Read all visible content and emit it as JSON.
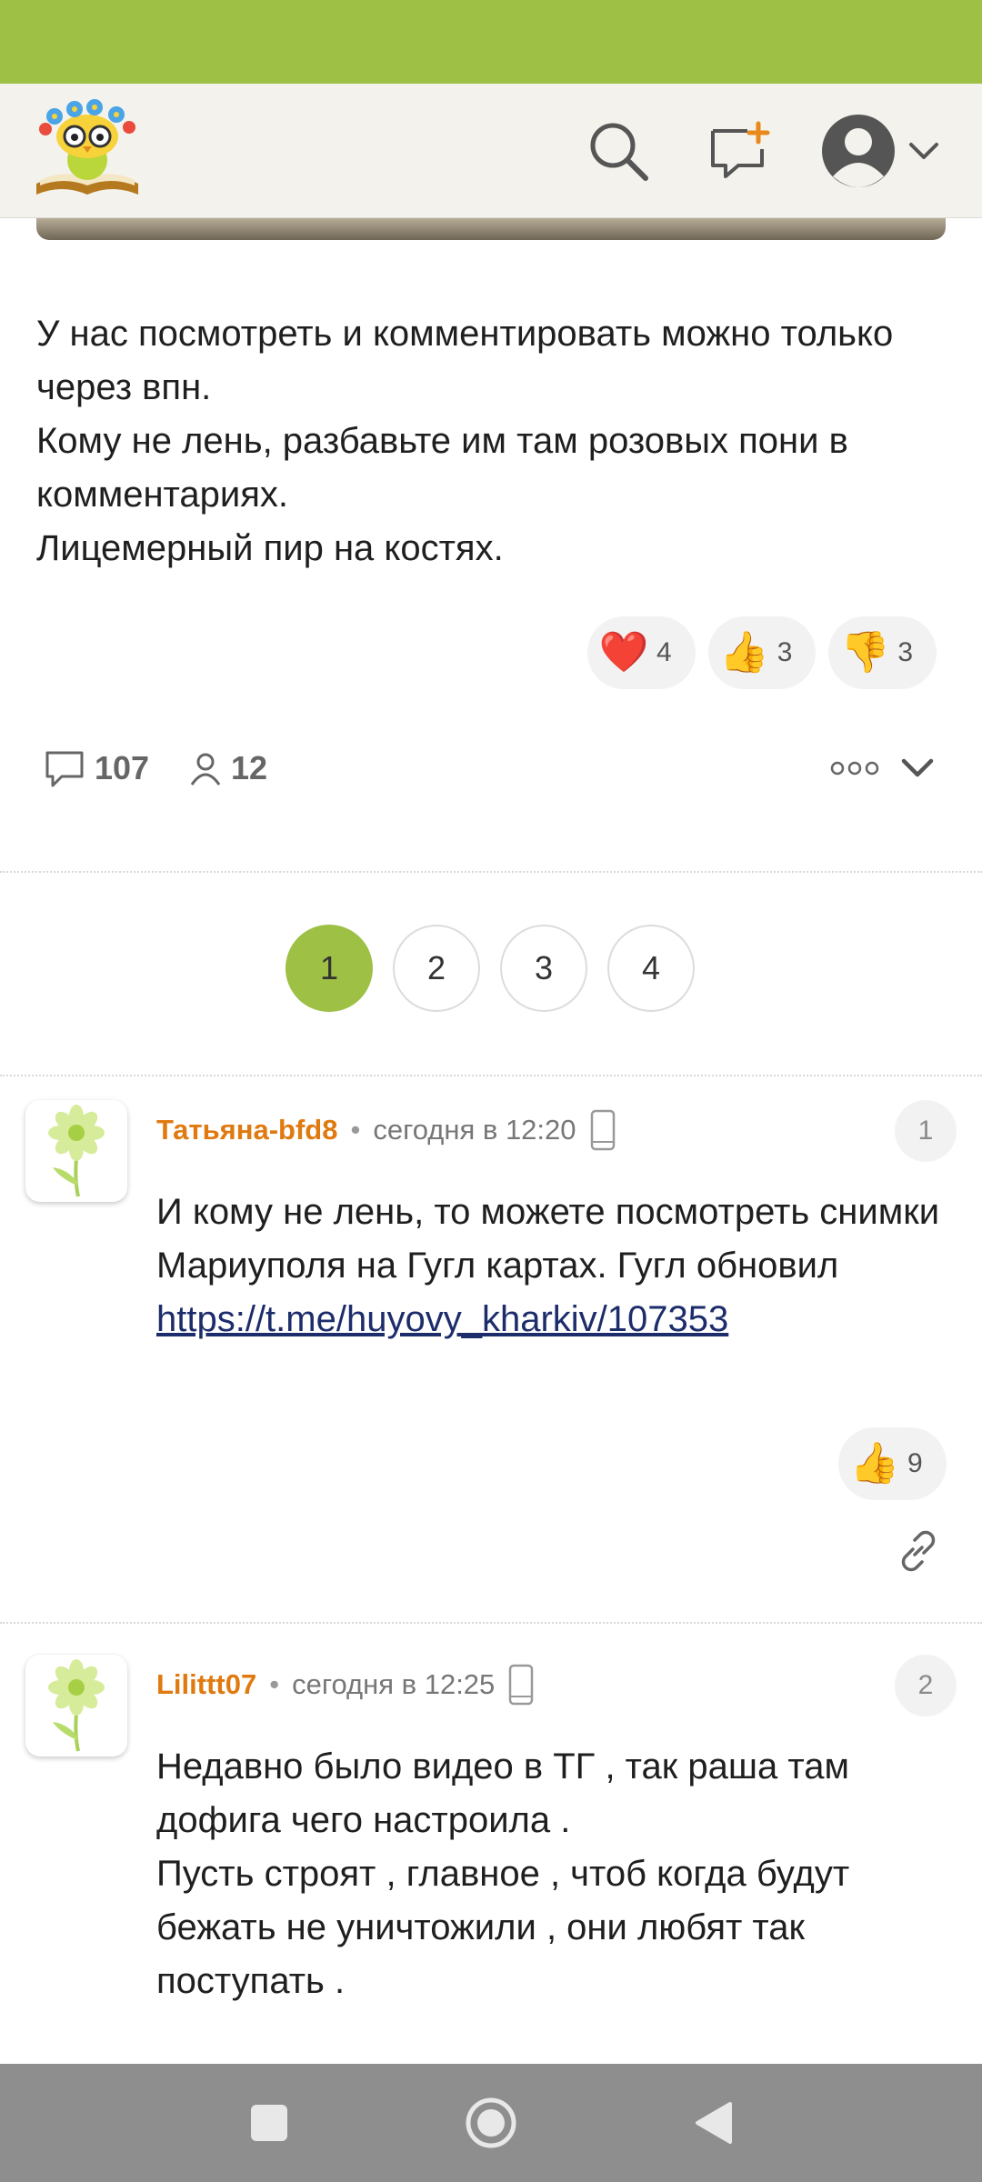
{
  "colors": {
    "brand_green": "#9dc045",
    "author_orange": "#e07a10",
    "link_navy": "#1d2d6b"
  },
  "header": {
    "logo": "owl-on-book-logo",
    "icons": [
      "search-icon",
      "new-message-icon",
      "user-avatar-icon",
      "chevron-down-icon"
    ]
  },
  "post": {
    "paragraphs": [
      "У нас посмотреть и комментировать можно только через впн.",
      "Кому не лень, разбавьте им там розовых пони в комментариях.",
      "Лицемерный пир на костях."
    ],
    "reactions": [
      {
        "emoji": "❤️",
        "icon": "heart-icon",
        "count": "4"
      },
      {
        "emoji": "👍",
        "icon": "thumbs-up-icon",
        "count": "3"
      },
      {
        "emoji": "👎",
        "icon": "thumbs-down-icon",
        "count": "3"
      }
    ],
    "comments_count": "107",
    "followers_count": "12"
  },
  "pagination": {
    "pages": [
      "1",
      "2",
      "3",
      "4"
    ],
    "current": "1"
  },
  "comments": [
    {
      "author": "Татьяна-bfd8",
      "separator": "•",
      "time": "сегодня в 12:20",
      "number": "1",
      "text_lines": [
        "И кому не лень, то можете посмотреть снимки Мариуполя на Гугл картах. Гугл обновил"
      ],
      "link": "https://t.me/huyovy_kharkiv/107353",
      "reactions": [
        {
          "emoji": "👍",
          "icon": "thumbs-up-icon",
          "count": "9"
        }
      ]
    },
    {
      "author": "Lilittt07",
      "separator": "•",
      "time": "сегодня в 12:25",
      "number": "2",
      "text_lines": [
        "Недавно было видео в ТГ , так раша там дофига чего настроила .",
        "Пусть строят , главное , чтоб когда будут бежать не уничтожили , они любят так поступать ."
      ]
    }
  ]
}
